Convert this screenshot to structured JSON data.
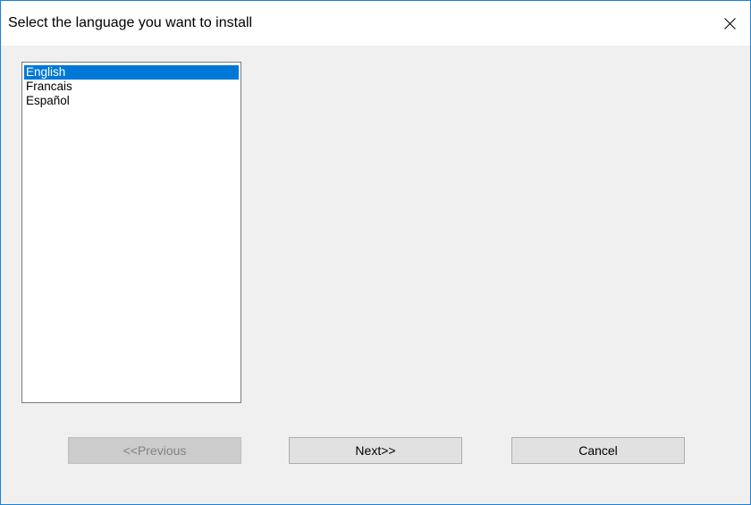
{
  "window": {
    "title": "Select the language you want to install"
  },
  "icons": {
    "close": "close-icon"
  },
  "languages": {
    "items": [
      {
        "label": "English",
        "selected": true
      },
      {
        "label": "Francais",
        "selected": false
      },
      {
        "label": "Español",
        "selected": false
      }
    ]
  },
  "buttons": {
    "previous": {
      "label": "<<Previous",
      "enabled": false
    },
    "next": {
      "label": "Next>>",
      "enabled": true
    },
    "cancel": {
      "label": "Cancel",
      "enabled": true
    }
  },
  "colors": {
    "selection": "#0078d7",
    "window_border": "#1883d7",
    "dialog_background": "#f0f0f0"
  }
}
